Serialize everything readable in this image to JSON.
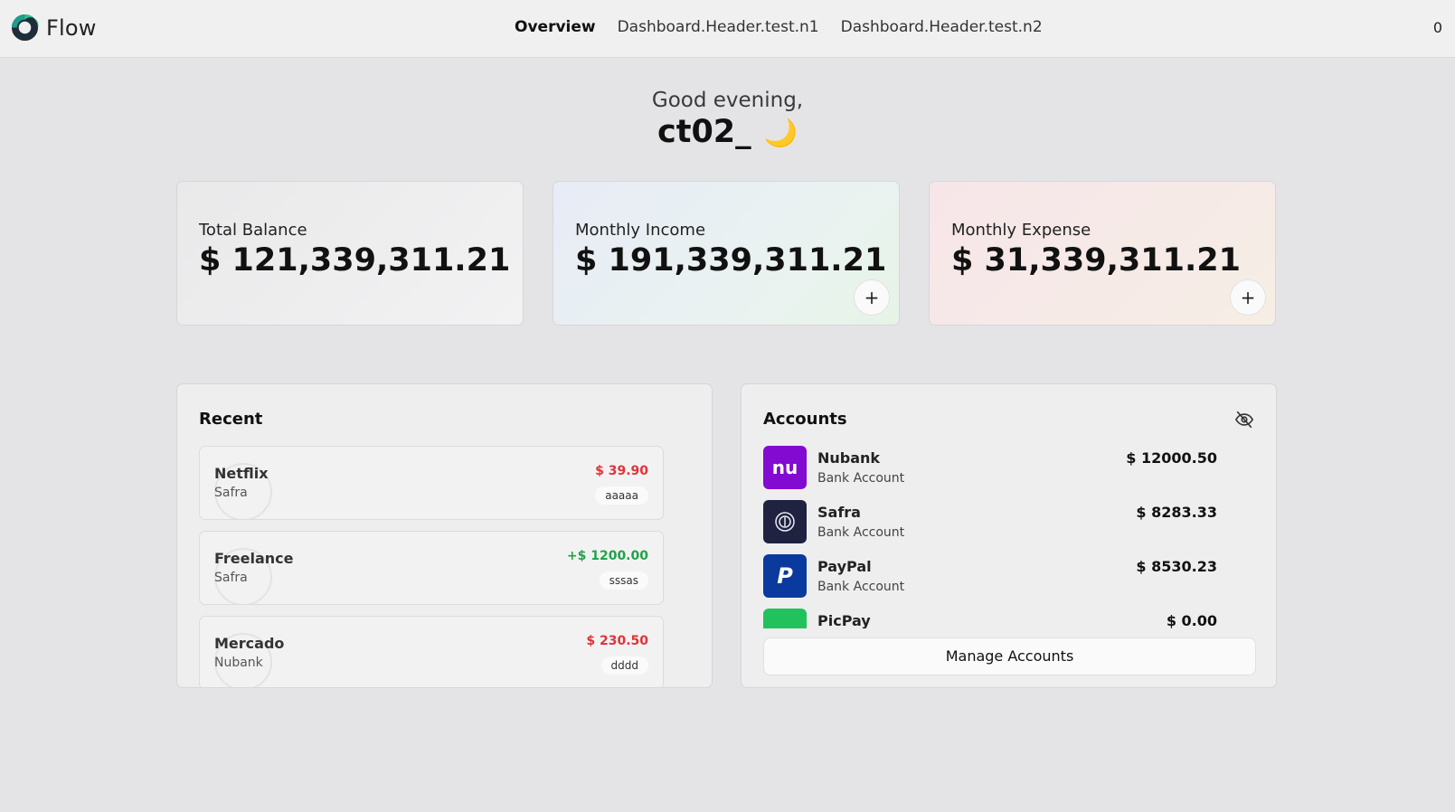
{
  "app": {
    "name": "Flow",
    "accent_color": "#1f9c8a"
  },
  "nav": {
    "items": [
      {
        "label": "Overview",
        "active": true
      },
      {
        "label": "Dashboard.Header.test.n1",
        "active": false
      },
      {
        "label": "Dashboard.Header.test.n2",
        "active": false
      }
    ],
    "counter": "0"
  },
  "greeting": {
    "line1": "Good evening,",
    "username": "ct02_",
    "emoji": "🌙"
  },
  "summary": {
    "balance": {
      "label": "Total Balance",
      "value": "$ 121,339,311.21"
    },
    "income": {
      "label": "Monthly Income",
      "value": "$ 191,339,311.21",
      "add_icon": "+"
    },
    "expense": {
      "label": "Monthly Expense",
      "value": "$ 31,339,311.21",
      "add_icon": "+"
    }
  },
  "recent": {
    "title": "Recent",
    "transactions": [
      {
        "name": "Netflix",
        "bank": "Safra",
        "amount": "$ 39.90",
        "tag": "aaaaa",
        "kind": "expense"
      },
      {
        "name": "Freelance",
        "bank": "Safra",
        "amount": "+$ 1200.00",
        "tag": "sssas",
        "kind": "income"
      },
      {
        "name": "Mercado",
        "bank": "Nubank",
        "amount": "$ 230.50",
        "tag": "dddd",
        "kind": "expense"
      }
    ]
  },
  "accounts": {
    "title": "Accounts",
    "visibility_icon": "eye-off-icon",
    "items": [
      {
        "name": "Nubank",
        "type": "Bank Account",
        "balance": "$ 12000.50",
        "logo_text": "nu",
        "color": "#820ad1"
      },
      {
        "name": "Safra",
        "type": "Bank Account",
        "balance": "$ 8283.33",
        "logo_text": "",
        "color": "#1f2240"
      },
      {
        "name": "PayPal",
        "type": "Bank Account",
        "balance": "$ 8530.23",
        "logo_text": "P",
        "color": "#0a3a9e"
      },
      {
        "name": "PicPay",
        "type": "",
        "balance": "$ 0.00",
        "logo_text": "",
        "color": "#21c25e"
      }
    ],
    "manage_label": "Manage Accounts"
  }
}
